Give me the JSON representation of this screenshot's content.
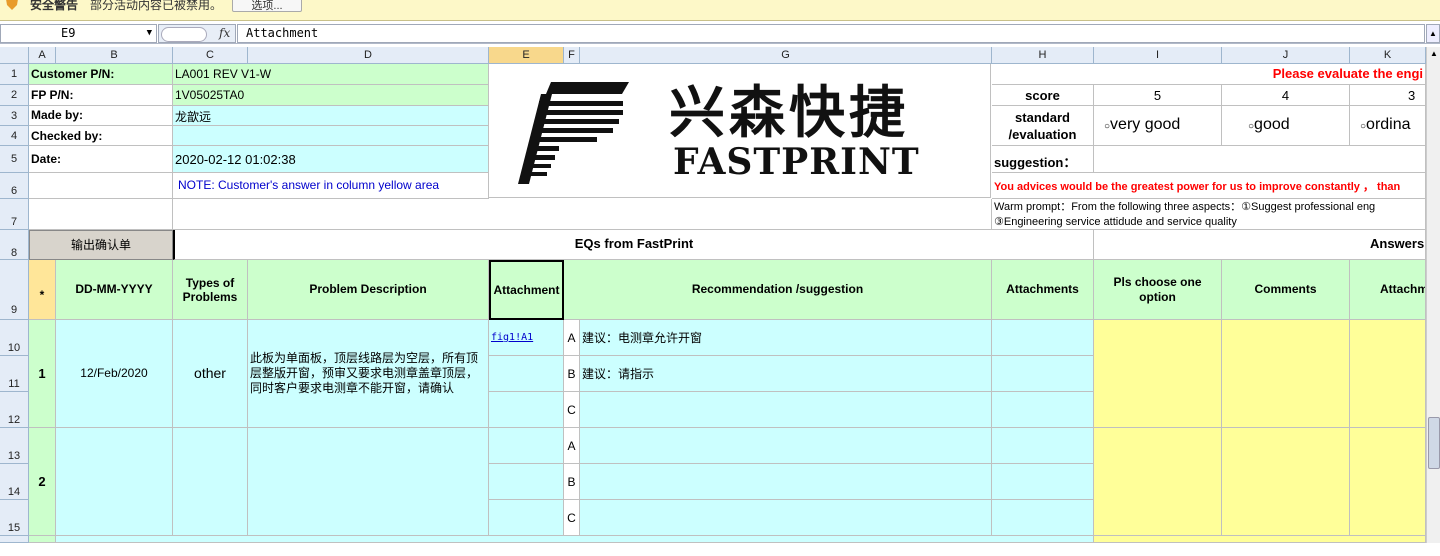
{
  "security_bar": {
    "title": "安全警告",
    "message": "部分活动内容已被禁用。",
    "options_label": "选项..."
  },
  "formula_bar": {
    "name_box": "E9",
    "fx_label": "fx",
    "formula": "Attachment"
  },
  "columns": [
    "A",
    "B",
    "C",
    "D",
    "E",
    "F",
    "G",
    "H",
    "I",
    "J",
    "K"
  ],
  "rows": [
    "1",
    "2",
    "3",
    "4",
    "5",
    "6",
    "7",
    "8",
    "9",
    "10",
    "11",
    "12",
    "13",
    "14",
    "15"
  ],
  "header_info": {
    "customer_pn_label": "Customer P/N:",
    "customer_pn": "LA001 REV V1-W",
    "fp_pn_label": "FP P/N:",
    "fp_pn": "1V05025TA0",
    "made_by_label": "Made by:",
    "made_by": "龙歆远",
    "checked_by_label": "Checked by:",
    "checked_by": "",
    "date_label": "Date:",
    "date": "2020-02-12 01:02:38",
    "note": "NOTE: Customer's  answer in column yellow area"
  },
  "logo": {
    "chinese": "兴森快捷",
    "english": "FASTPRINT"
  },
  "evaluation": {
    "title": "Please evaluate the engi",
    "score_label": "score",
    "scores": [
      "5",
      "4",
      "3"
    ],
    "standard_label_1": "standard",
    "standard_label_2": "/evaluation",
    "options": [
      "very good",
      "good",
      "ordina"
    ],
    "suggestion_label": "suggestion：",
    "advice": "You advices would be the greatest power for us to improve constantly ，  than",
    "warm_prompt_1": "Warm prompt：From the following three aspects：①Suggest professional eng",
    "warm_prompt_2": "③Engineering service attidude and service quality"
  },
  "button_export": "输出确认单",
  "eqs_title": "EQs from FastPrint",
  "answers_title": "Answers",
  "table_headers": {
    "star": "*",
    "date": "DD-MM-YYYY",
    "types": "Types of Problems",
    "desc": "Problem Description",
    "attach": "Attachment",
    "recommend": "Recommendation /suggestion",
    "attachments": "Attachments",
    "choose": "Pls choose one option",
    "comments": "Comments",
    "attach2": "Attachm"
  },
  "eq_rows": [
    {
      "number": "1",
      "date": "12/Feb/2020",
      "type": "other",
      "description": "此板为单面板，顶层线路层为空层，所有顶层整版开窗，预审又要求电测章盖章顶层，同时客户要求电测章不能开窗，请确认",
      "attachment_link": "fig1!A1",
      "options": [
        {
          "letter": "A",
          "text": "建议：电测章允许开窗"
        },
        {
          "letter": "B",
          "text": "建议：请指示"
        },
        {
          "letter": "C",
          "text": ""
        }
      ]
    },
    {
      "number": "2",
      "date": "",
      "type": "",
      "description": "",
      "attachment_link": "",
      "options": [
        {
          "letter": "A",
          "text": ""
        },
        {
          "letter": "B",
          "text": ""
        },
        {
          "letter": "C",
          "text": ""
        }
      ]
    }
  ],
  "colors": {
    "green": "#ccffcc",
    "cyan": "#ccffff",
    "yellow": "#ffff99",
    "red": "#ff0000",
    "blue_note": "#0000cc",
    "header_bg": "#e4ecf7",
    "selected_header": "#f8d88c"
  }
}
